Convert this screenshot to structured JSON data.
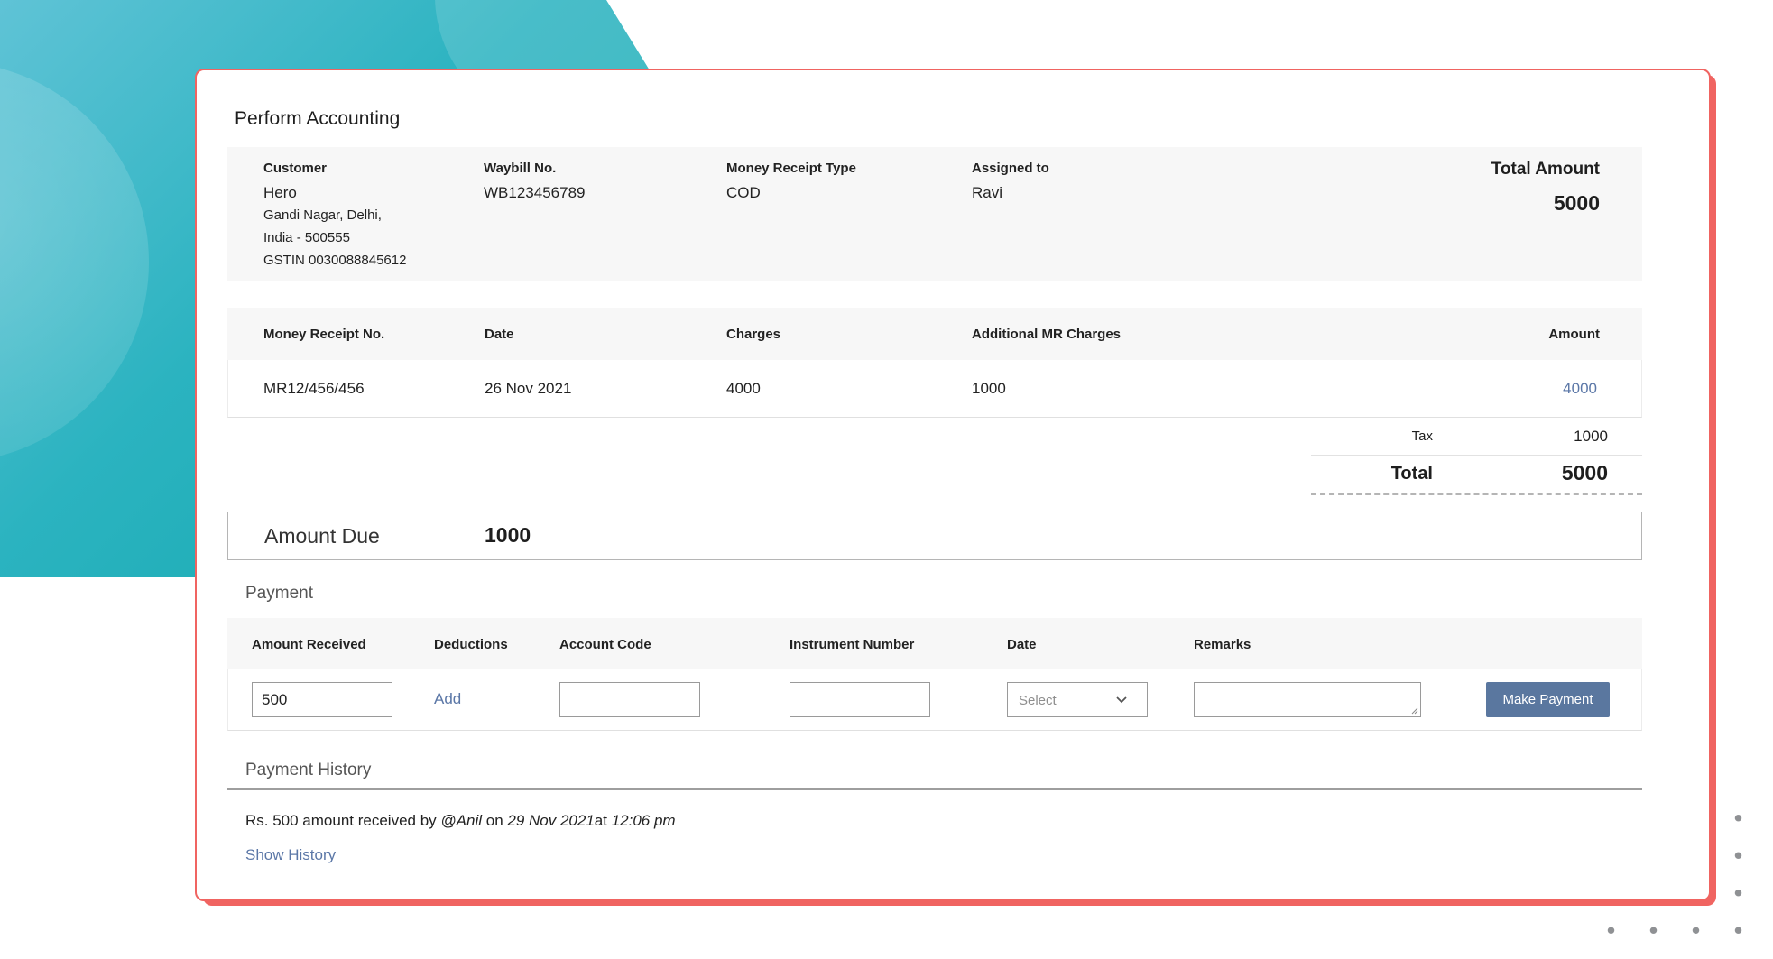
{
  "title": "Perform Accounting",
  "summary": {
    "customer_label": "Customer",
    "customer_name": "Hero",
    "customer_address_1": "Gandi Nagar, Delhi,",
    "customer_address_2": "India - 500555",
    "customer_gstin": "GSTIN 0030088845612",
    "waybill_label": "Waybill No.",
    "waybill_value": "WB123456789",
    "mr_type_label": "Money Receipt Type",
    "mr_type_value": "COD",
    "assigned_label": "Assigned to",
    "assigned_value": "Ravi",
    "total_amount_label": "Total Amount",
    "total_amount_value": "5000"
  },
  "receipt_table": {
    "headers": [
      "Money Receipt No.",
      "Date",
      "Charges",
      "Additional MR Charges",
      "Amount"
    ],
    "row": [
      "MR12/456/456",
      "26 Nov 2021",
      "4000",
      "1000",
      "4000"
    ],
    "tax_label": "Tax",
    "tax_value": "1000",
    "total_label": "Total",
    "total_value": "5000"
  },
  "amount_due": {
    "label": "Amount Due",
    "value": "1000"
  },
  "payment": {
    "section_title": "Payment",
    "headers": [
      "Amount Received",
      "Deductions",
      "Account Code",
      "Instrument Number",
      "Date",
      "Remarks"
    ],
    "amount_received_value": "500",
    "deductions_link": "Add",
    "date_placeholder": "Select",
    "make_payment_label": "Make Payment"
  },
  "history": {
    "section_title": "Payment History",
    "entry_prefix": "Rs. 500 amount received by ",
    "entry_user": "@Anil",
    "entry_on": " on ",
    "entry_date": "29 Nov 2021",
    "entry_at": "at ",
    "entry_time": "12:06 pm",
    "show_history_label": "Show History"
  },
  "colors": {
    "accent": "#f06461",
    "button": "#5a779f",
    "link": "#5b77a7",
    "teal": "#12a8ad"
  },
  "icons": {
    "date_select": "chevron-down-icon"
  }
}
